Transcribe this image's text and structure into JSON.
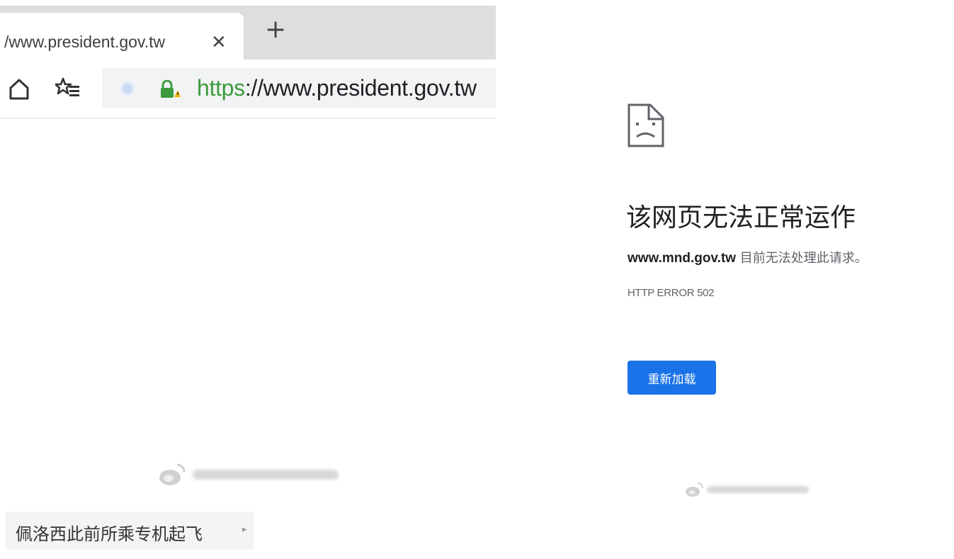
{
  "browser": {
    "tab": {
      "title": "/www.president.gov.tw",
      "close_glyph": "✕"
    },
    "new_tab_glyph": "+",
    "toolbar": {
      "home_icon": "home-icon",
      "favorites_icon": "favorites-icon",
      "secure_icon": "lock-icon"
    },
    "address": {
      "scheme": "https",
      "rest": "://www.president.gov.tw"
    }
  },
  "error_page": {
    "icon": "sad-page-icon",
    "title": "该网页无法正常运作",
    "host": "www.mnd.gov.tw",
    "message": " 目前无法处理此请求。",
    "error_code": "HTTP ERROR 502",
    "reload_label": "重新加载",
    "reload_color": "#1a73e8"
  },
  "caption": {
    "text": "佩洛西此前所乘专机起飞",
    "arrow": "▸"
  },
  "colors": {
    "tabstrip": "#dedede",
    "https_green": "#3c9b3c"
  }
}
